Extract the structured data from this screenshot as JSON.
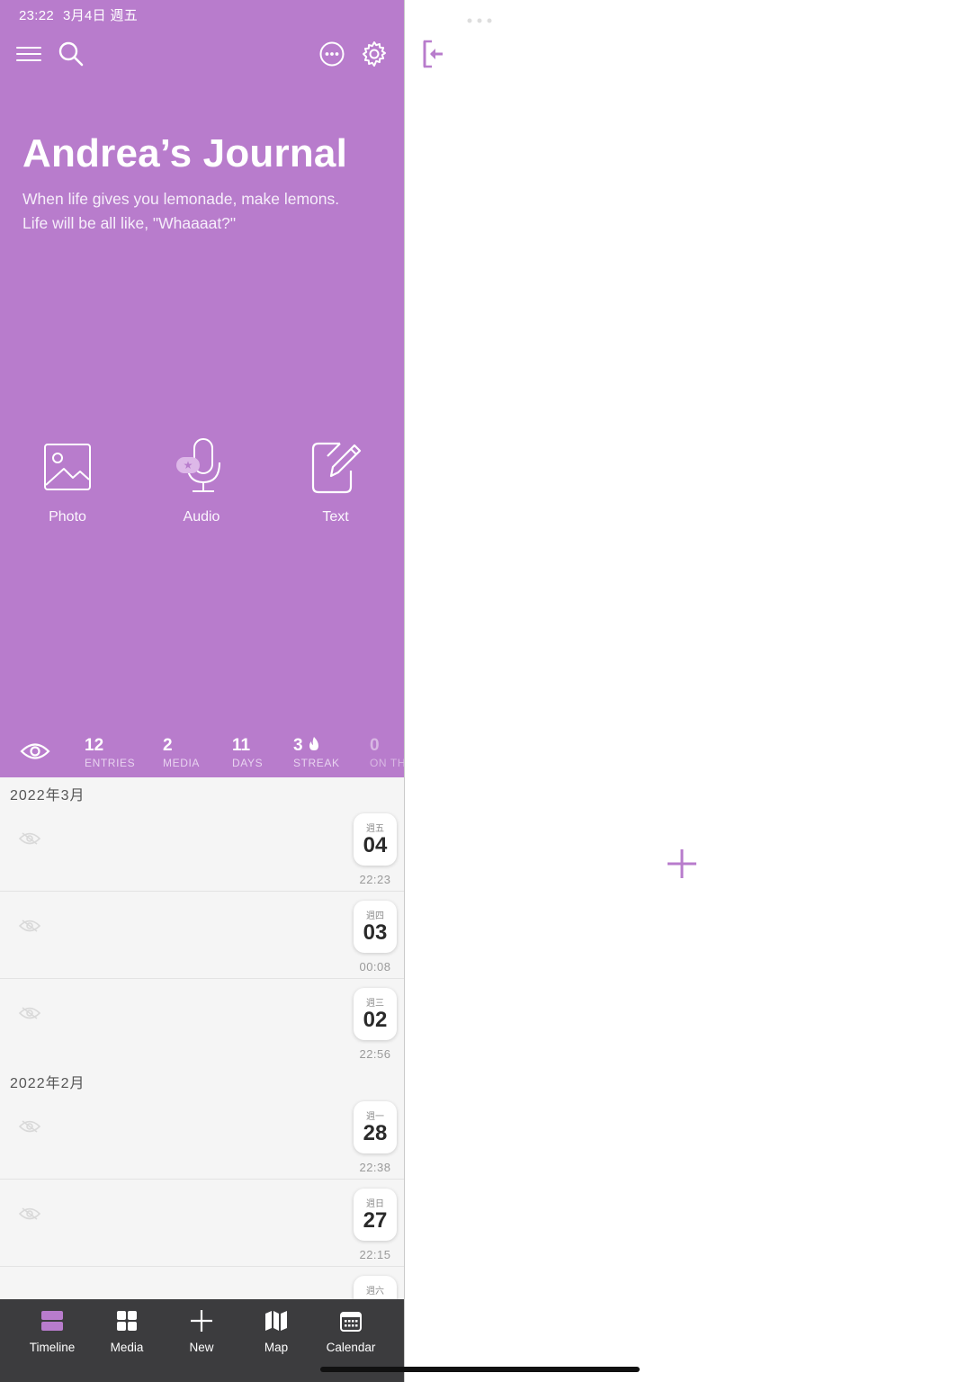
{
  "status_bar": {
    "time": "23:22",
    "date": "3月4日 週五"
  },
  "journal": {
    "title": "Andrea’s Journal",
    "subtitle_line1": "When life gives you lemonade, make lemons.",
    "subtitle_line2": "Life will be all like, \"Whaaaat?\""
  },
  "quick_actions": [
    {
      "label": "Photo",
      "icon": "photo-icon"
    },
    {
      "label": "Audio",
      "icon": "microphone-icon"
    },
    {
      "label": "Text",
      "icon": "compose-icon"
    }
  ],
  "stats": [
    {
      "value": "12",
      "label": "ENTRIES"
    },
    {
      "value": "2",
      "label": "MEDIA"
    },
    {
      "value": "11",
      "label": "DAYS"
    },
    {
      "value": "3",
      "label": "STREAK"
    },
    {
      "value": "0",
      "label": "ON TH"
    }
  ],
  "timeline": {
    "months": [
      "2022年3月",
      "2022年2月"
    ],
    "entries": [
      {
        "dow": "週五",
        "day": "04",
        "time": "22:23"
      },
      {
        "dow": "週四",
        "day": "03",
        "time": "00:08"
      },
      {
        "dow": "週三",
        "day": "02",
        "time": "22:56"
      },
      {
        "dow": "週一",
        "day": "28",
        "time": "22:38"
      },
      {
        "dow": "週日",
        "day": "27",
        "time": "22:15"
      },
      {
        "dow": "週六",
        "day": "",
        "time": ""
      }
    ]
  },
  "tabbar": [
    {
      "label": "Timeline",
      "icon": "timeline-icon",
      "active": true
    },
    {
      "label": "Media",
      "icon": "grid-icon"
    },
    {
      "label": "New",
      "icon": "plus-icon"
    },
    {
      "label": "Map",
      "icon": "map-icon"
    },
    {
      "label": "Calendar",
      "icon": "calendar-icon"
    }
  ],
  "colors": {
    "accent": "#b87ccc",
    "tabbar": "#3c3c3e",
    "background": "#f5f5f5"
  }
}
